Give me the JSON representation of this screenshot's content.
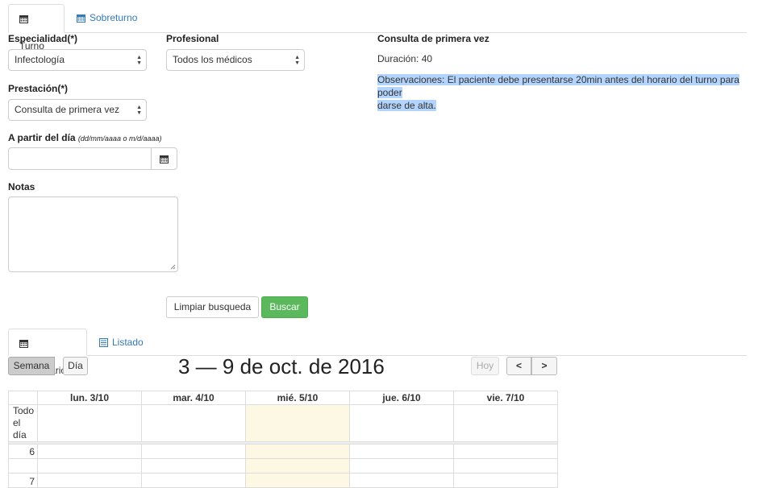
{
  "top_tabs": [
    {
      "label": "Turno",
      "icon": "calendar-icon",
      "active": true
    },
    {
      "label": "Sobreturno",
      "icon": "calendar-icon",
      "active": false
    }
  ],
  "form": {
    "especialidad_label": "Especialidad(*)",
    "especialidad_value": "Infectología",
    "profesional_label": "Profesional",
    "profesional_value": "Todos los médicos",
    "prestacion_label": "Prestación(*)",
    "prestacion_value": "Consulta de primera vez",
    "fecha_label": "A partir del día",
    "fecha_hint": "(dd/mm/aaaa o m/d/aaaa)",
    "fecha_value": "",
    "notas_label": "Notas",
    "notas_value": "",
    "limpiar_label": "Limpiar busqueda",
    "buscar_label": "Buscar"
  },
  "info": {
    "title": "Consulta de primera vez",
    "duracion": "Duración: 40",
    "observaciones_line1": "Observaciones: El paciente debe presentarse 20min antes del horario del turno para poder",
    "observaciones_line2": "darse de alta."
  },
  "view_tabs": [
    {
      "label": "Calendario",
      "icon": "calendar-icon",
      "active": true
    },
    {
      "label": "Listado",
      "icon": "list-icon",
      "active": false
    }
  ],
  "calendar": {
    "semana_label": "Semana",
    "dia_label": "Día",
    "title": "3 — 9 de oct. de 2016",
    "hoy_label": "Hoy",
    "prev_symbol": "<",
    "next_symbol": ">",
    "days": [
      "lun. 3/10",
      "mar. 4/10",
      "mié. 5/10",
      "jue. 6/10",
      "vie. 7/10"
    ],
    "allday_line1": "Todo",
    "allday_line2": "el día",
    "hours": [
      "6",
      "7"
    ],
    "today_color": "#fcf8e3"
  }
}
